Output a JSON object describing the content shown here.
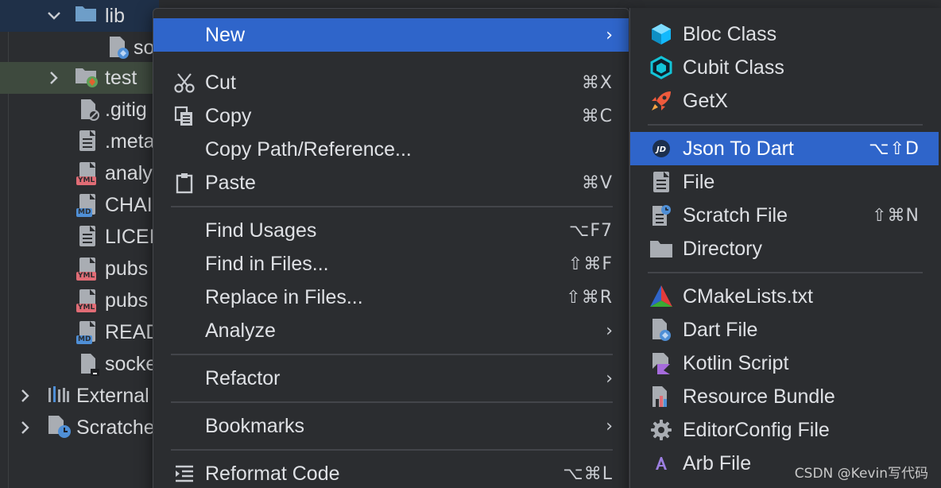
{
  "project_tree": {
    "items": [
      {
        "label": "lib",
        "icon": "folder-icon"
      },
      {
        "label": "so",
        "icon": "dart-file-icon"
      },
      {
        "label": "test",
        "icon": "test-folder-icon"
      },
      {
        "label": ".gitig",
        "icon": "ignore-file-icon"
      },
      {
        "label": ".meta",
        "icon": "text-file-icon"
      },
      {
        "label": "analy",
        "icon": "yml-file-icon"
      },
      {
        "label": "CHAI",
        "icon": "md-file-icon"
      },
      {
        "label": "LICEI",
        "icon": "text-file-icon"
      },
      {
        "label": "pubs",
        "icon": "yml-file-icon"
      },
      {
        "label": "pubs",
        "icon": "yml-file-icon"
      },
      {
        "label": "READ",
        "icon": "md-file-icon"
      },
      {
        "label": "socke",
        "icon": "script-file-icon"
      },
      {
        "label": "External",
        "icon": "libraries-icon"
      },
      {
        "label": "Scratche",
        "icon": "scratches-icon"
      }
    ],
    "tags": {
      "yml": "YML",
      "md": "MD"
    }
  },
  "context_menu": {
    "new": {
      "label": "New",
      "arrow": "›"
    },
    "cut": {
      "label": "Cut",
      "shortcut": "⌘X"
    },
    "copy": {
      "label": "Copy",
      "shortcut": "⌘C"
    },
    "copy_path": {
      "label": "Copy Path/Reference..."
    },
    "paste": {
      "label": "Paste",
      "shortcut": "⌘V"
    },
    "find_usages": {
      "label": "Find Usages",
      "shortcut": "⌥F7"
    },
    "find_in_files": {
      "label": "Find in Files...",
      "shortcut": "⇧⌘F"
    },
    "replace_in_files": {
      "label": "Replace in Files...",
      "shortcut": "⇧⌘R"
    },
    "analyze": {
      "label": "Analyze",
      "arrow": "›"
    },
    "refactor": {
      "label": "Refactor",
      "arrow": "›"
    },
    "bookmarks": {
      "label": "Bookmarks",
      "arrow": "›"
    },
    "reformat": {
      "label": "Reformat Code",
      "shortcut": "⌥⌘L"
    }
  },
  "submenu": {
    "bloc_class": {
      "label": "Bloc Class"
    },
    "cubit_class": {
      "label": "Cubit Class"
    },
    "getx": {
      "label": "GetX"
    },
    "json_to_dart": {
      "label": "Json To Dart",
      "shortcut": "⌥⇧D",
      "badge": "JD"
    },
    "file": {
      "label": "File"
    },
    "scratch_file": {
      "label": "Scratch File",
      "shortcut": "⇧⌘N"
    },
    "directory": {
      "label": "Directory"
    },
    "cmakelists": {
      "label": "CMakeLists.txt"
    },
    "dart_file": {
      "label": "Dart File"
    },
    "kotlin_script": {
      "label": "Kotlin Script"
    },
    "resource_bundle": {
      "label": "Resource Bundle"
    },
    "editorconfig": {
      "label": "EditorConfig File"
    },
    "arb_file": {
      "label": "Arb File"
    }
  },
  "watermark": "CSDN @Kevin写代码",
  "colors": {
    "background": "#2b2d30",
    "selection": "#2f65ca",
    "separator": "#43454a",
    "text": "#dfe1e5"
  }
}
